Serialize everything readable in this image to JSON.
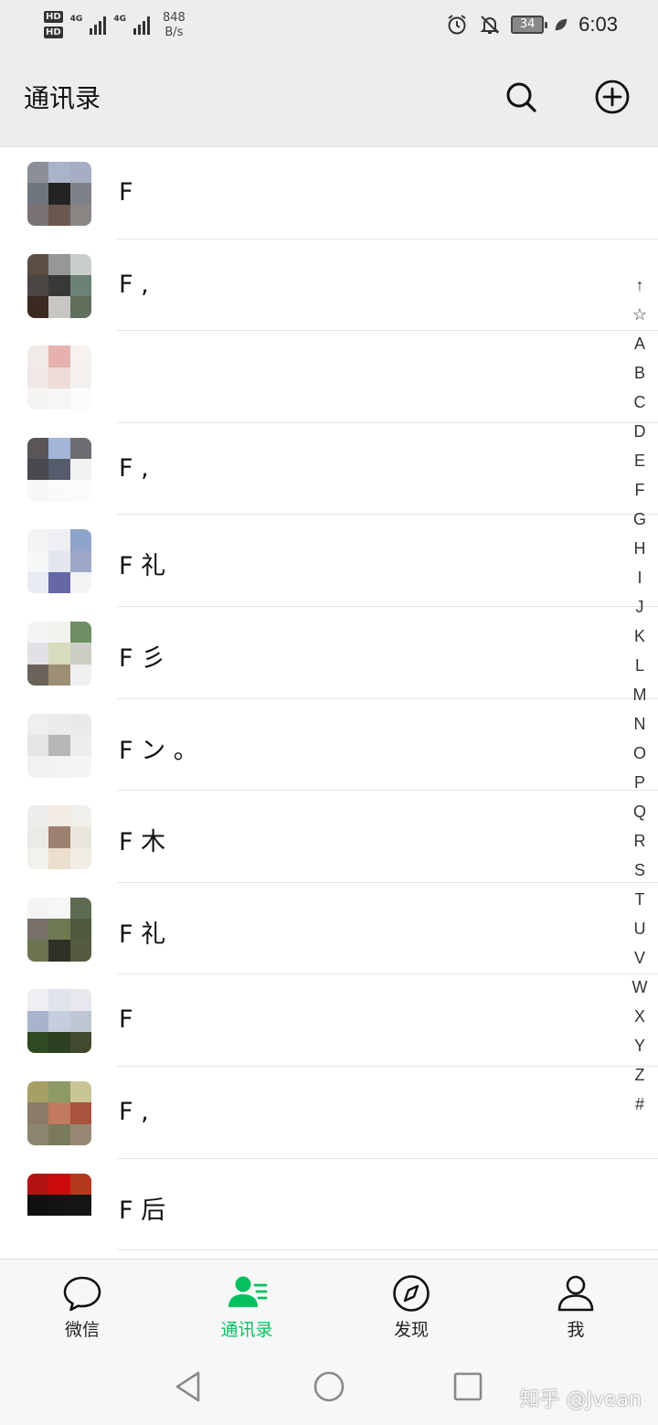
{
  "status_bar": {
    "hd1": "HD",
    "hd2": "HD",
    "net1": "4G",
    "net2": "4G",
    "speed_value": "848",
    "speed_unit": "B/s",
    "battery": "34",
    "time": "6:03"
  },
  "header": {
    "title": "通讯录",
    "icons": [
      "search-icon",
      "add-circle-icon"
    ]
  },
  "contacts": [
    {
      "name": "F",
      "avatar": [
        "#8a8f99",
        "#a9b3c9",
        "#a5aec2",
        "#6f757e",
        "#232323",
        "#7e8288",
        "#787274",
        "#6a5850",
        "#8a8583"
      ]
    },
    {
      "name": "F ,",
      "avatar": [
        "#5a4e44",
        "#969796",
        "#c9cdcb",
        "#4b4644",
        "#383838",
        "#6c8275",
        "#3a2a22",
        "#c8c6c2",
        "#5f6f5c"
      ]
    },
    {
      "name": "",
      "avatar": [
        "#f1ecea",
        "#e6b1ae",
        "#f5f2f0",
        "#efe8e6",
        "#efdcd6",
        "#f3f0ee",
        "#f6f4f3",
        "#f7f6f5",
        "#fbfbfb"
      ]
    },
    {
      "name": "F ,",
      "avatar": [
        "#5a5558",
        "#a3b6d8",
        "#6c6c72",
        "#494a4f",
        "#565c6c",
        "#f2f2f2",
        "#f7f7f7",
        "#fafafa",
        "#fbfbfb"
      ]
    },
    {
      "name": "F 礼",
      "avatar": [
        "#f3f3f3",
        "#eeeff3",
        "#8fa4c9",
        "#f6f7f8",
        "#e4e6ed",
        "#9fa9c7",
        "#e8ebf1",
        "#6568a4",
        "#f4f4f6"
      ]
    },
    {
      "name": "F 彡",
      "avatar": [
        "#f5f5f5",
        "#f2f2ee",
        "#6f8e63",
        "#e1e2e5",
        "#d9dbbf",
        "#cacec4",
        "#6b625a",
        "#9c8f76",
        "#efefef"
      ]
    },
    {
      "name": "F ン 。",
      "avatar": [
        "#efefef",
        "#ebebeb",
        "#e9e9e9",
        "#e5e5e5",
        "#b6b6b6",
        "#eeeeee",
        "#f1f1f1",
        "#f3f3f3",
        "#f5f5f5"
      ]
    },
    {
      "name": "F 木",
      "avatar": [
        "#eeefec",
        "#f3ece4",
        "#f1efea",
        "#e9ebe6",
        "#9d8070",
        "#e9e6df",
        "#f3f1ec",
        "#ebdfcf",
        "#f1ede6"
      ]
    },
    {
      "name": "F 礼",
      "avatar": [
        "#f4f4f4",
        "#f6f6f6",
        "#5f6a52",
        "#77706a",
        "#6f7a53",
        "#4f5a3c",
        "#6b744f",
        "#2f3126",
        "#545b3f"
      ]
    },
    {
      "name": "F",
      "avatar": [
        "#eeeff2",
        "#dfe3ea",
        "#e6e8ee",
        "#a8b4cc",
        "#c4cedd",
        "#bfc6d3",
        "#2f4a22",
        "#2c3f1f",
        "#414a2d"
      ]
    },
    {
      "name": "F ,",
      "avatar": [
        "#a7a064",
        "#8e9a66",
        "#c9c597",
        "#8b7b68",
        "#c27a60",
        "#a8543e",
        "#8c8670",
        "#7a7a5c",
        "#988873"
      ]
    },
    {
      "name": "F 后",
      "avatar": [
        "#b21414",
        "#cc0a0a",
        "#b33a1c",
        "#111111",
        "#141414",
        "#151515",
        "#ffffff",
        "#ffffff",
        "#ffffff"
      ]
    }
  ],
  "index": [
    "↑",
    "☆",
    "A",
    "B",
    "C",
    "D",
    "E",
    "F",
    "G",
    "H",
    "I",
    "J",
    "K",
    "L",
    "M",
    "N",
    "O",
    "P",
    "Q",
    "R",
    "S",
    "T",
    "U",
    "V",
    "W",
    "X",
    "Y",
    "Z",
    "#"
  ],
  "tabs": [
    {
      "label": "微信",
      "icon": "chat-bubble-icon",
      "active": false
    },
    {
      "label": "通讯录",
      "icon": "contacts-icon",
      "active": true
    },
    {
      "label": "发现",
      "icon": "compass-icon",
      "active": false
    },
    {
      "label": "我",
      "icon": "person-icon",
      "active": false
    }
  ],
  "system_nav": {
    "icons": [
      "back-triangle-icon",
      "home-circle-icon",
      "recents-square-icon"
    ]
  },
  "watermark": "知乎 @Jvean",
  "colors": {
    "accent": "#07c160",
    "background": "#ededed"
  }
}
